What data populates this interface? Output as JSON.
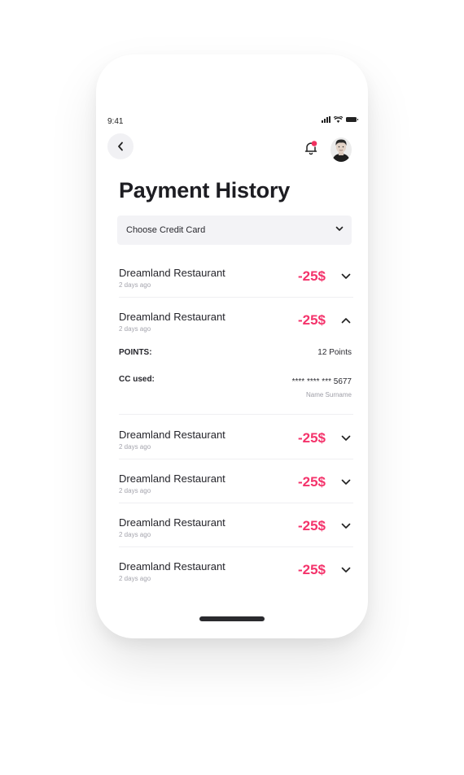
{
  "status_bar": {
    "time": "9:41"
  },
  "header": {
    "title": "Payment History"
  },
  "filter": {
    "label": "Choose Credit Card"
  },
  "payments": [
    {
      "merchant": "Dreamland Restaurant",
      "date": "2 days ago",
      "amount": "-25$",
      "expanded": false
    },
    {
      "merchant": "Dreamland Restaurant",
      "date": "2 days ago",
      "amount": "-25$",
      "expanded": true
    },
    {
      "merchant": "Dreamland Restaurant",
      "date": "2 days ago",
      "amount": "-25$",
      "expanded": false
    },
    {
      "merchant": "Dreamland Restaurant",
      "date": "2 days ago",
      "amount": "-25$",
      "expanded": false
    },
    {
      "merchant": "Dreamland Restaurant",
      "date": "2 days ago",
      "amount": "-25$",
      "expanded": false
    },
    {
      "merchant": "Dreamland Restaurant",
      "date": "2 days ago",
      "amount": "-25$",
      "expanded": false
    }
  ],
  "details": {
    "points_label": "POINTS:",
    "points_value": "12 Points",
    "cc_label": "CC used:",
    "cc_number": "**** **** *** 5677",
    "cc_holder": "Name Surname"
  },
  "icons": {
    "back": "chevron-left-icon",
    "notifications": "bell-icon",
    "expand": "chevron-down-icon",
    "collapse": "chevron-up-icon"
  },
  "colors": {
    "accent": "#f4336b",
    "notification_dot": "#f0305f",
    "surface": "#f3f3f6"
  }
}
